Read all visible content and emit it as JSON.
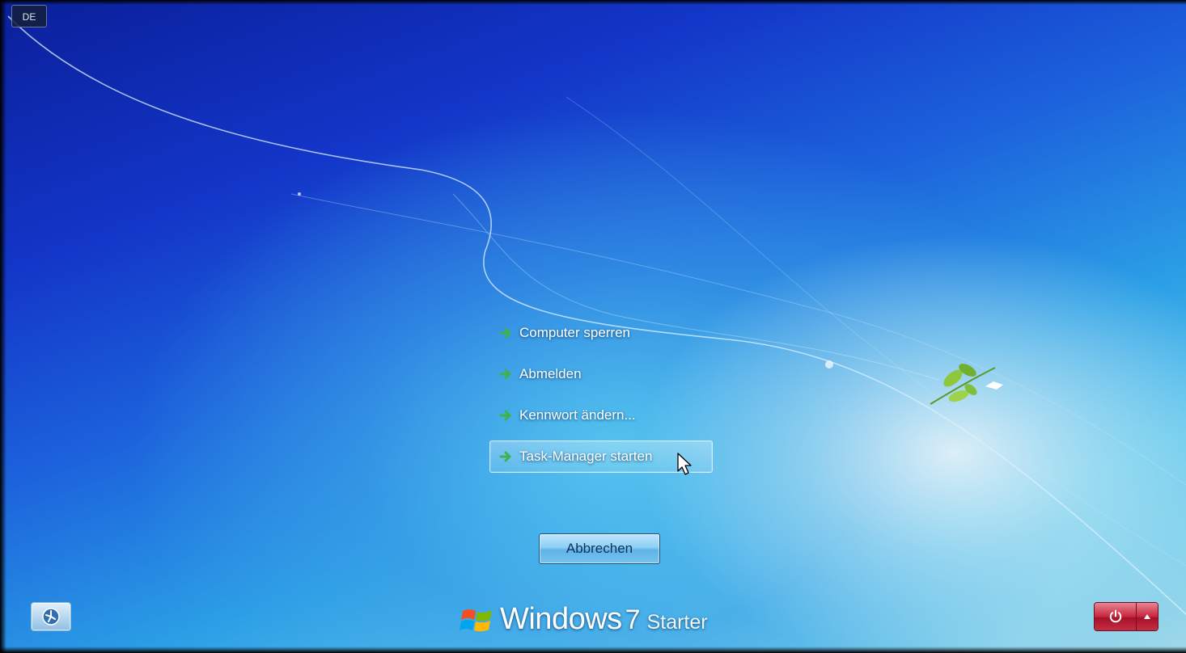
{
  "language_indicator": "DE",
  "menu": {
    "items": [
      {
        "label": "Computer sperren"
      },
      {
        "label": "Abmelden"
      },
      {
        "label": "Kennwort ändern..."
      },
      {
        "label": "Task-Manager starten",
        "hovered": true
      }
    ]
  },
  "cancel_label": "Abbrechen",
  "logo": {
    "word": "Windows",
    "version": "7",
    "edition": "Starter"
  },
  "icons": {
    "menu_arrow": "green-arrow-icon",
    "ease_of_access": "ease-of-access-icon",
    "power": "power-icon",
    "options": "triangle-up-icon",
    "logo_flag": "windows-flag-icon"
  },
  "colors": {
    "arrow_green": "#3fb24a",
    "power_red": "#c7263e",
    "cancel_blue": "#8dcff5"
  }
}
